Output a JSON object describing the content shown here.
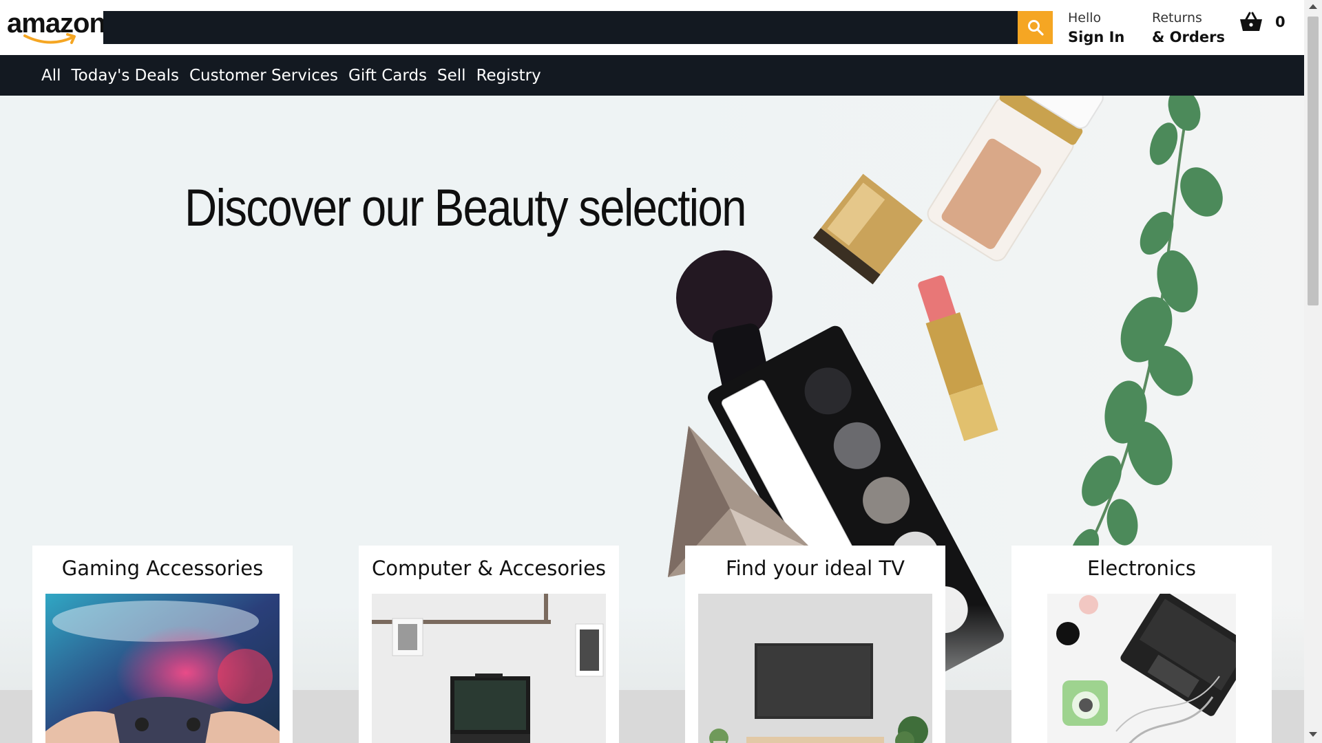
{
  "header": {
    "logo_text": "amazon",
    "search": {
      "value": "",
      "placeholder": ""
    },
    "account": {
      "greeting": "Hello",
      "action": "Sign In"
    },
    "orders": {
      "line1": "Returns",
      "line2": "& Orders"
    },
    "cart": {
      "count": "0",
      "icon": "basket-icon"
    },
    "colors": {
      "search_bg": "#131921",
      "search_button": "#f5a623"
    }
  },
  "subnav": {
    "items": [
      {
        "label": "All"
      },
      {
        "label": "Today's Deals"
      },
      {
        "label": "Customer Services"
      },
      {
        "label": "Gift Cards"
      },
      {
        "label": "Sell"
      },
      {
        "label": "Registry"
      }
    ]
  },
  "hero": {
    "title": "Discover our Beauty selection"
  },
  "cards": [
    {
      "title": "Gaming Accessories"
    },
    {
      "title": "Computer & Accesories"
    },
    {
      "title": "Find your ideal TV"
    },
    {
      "title": "Electronics"
    }
  ]
}
